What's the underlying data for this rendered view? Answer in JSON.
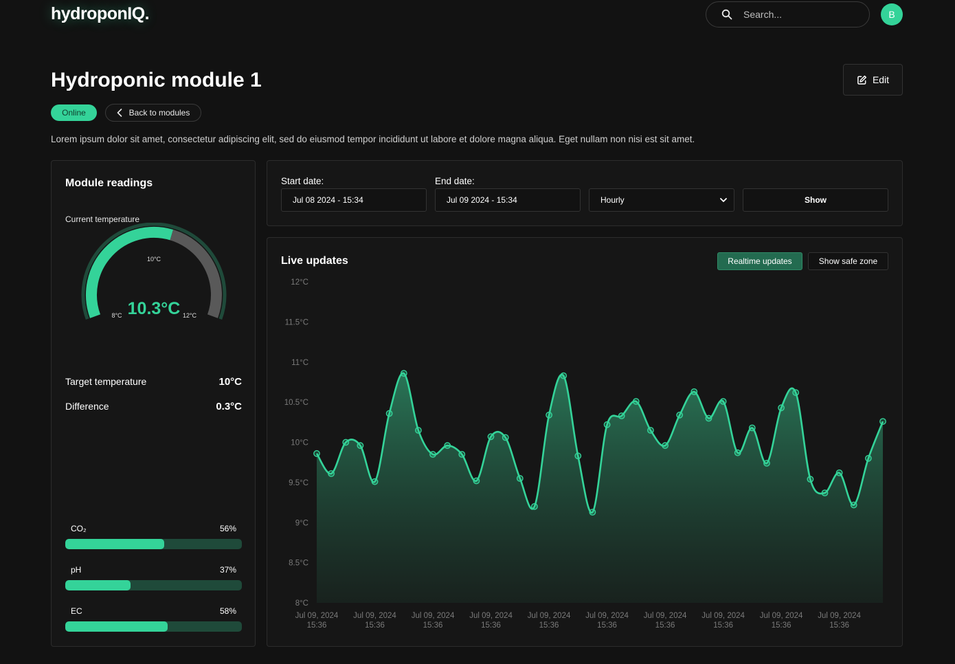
{
  "header": {
    "logo": "hydroponIQ.",
    "search_placeholder": "Search...",
    "avatar_initial": "B"
  },
  "page": {
    "title": "Hydroponic module 1",
    "edit_label": "Edit",
    "status_badge": "Online",
    "back_label": "Back to modules",
    "description": "Lorem ipsum dolor sit amet, consectetur adipiscing elit, sed do eiusmod tempor incididunt ut labore et dolore magna aliqua. Eget nullam non nisi est sit amet."
  },
  "readings": {
    "title": "Module readings",
    "gauge": {
      "label": "Current temperature",
      "value": "10.3°C",
      "current": 10.3,
      "min": 8,
      "max": 12,
      "target": 10,
      "min_label": "8°C",
      "mid_label": "10°C",
      "max_label": "12°C"
    },
    "target_label": "Target temperature",
    "target_value": "10°C",
    "difference_label": "Difference",
    "difference_value": "0.3°C",
    "bars": [
      {
        "label": "CO₂",
        "percent_label": "56%",
        "percent": 56
      },
      {
        "label": "pH",
        "percent_label": "37%",
        "percent": 37
      },
      {
        "label": "EC",
        "percent_label": "58%",
        "percent": 58
      }
    ]
  },
  "filters": {
    "start_label": "Start date:",
    "start_value": "Jul 08 2024 - 15:34",
    "end_label": "End date:",
    "end_value": "Jul 09 2024 - 15:34",
    "interval_value": "Hourly",
    "show_label": "Show"
  },
  "live": {
    "title": "Live updates",
    "realtime_label": "Realtime updates",
    "safe_zone_label": "Show safe zone"
  },
  "colors": {
    "accent": "#34d399",
    "accent_dark": "#236b50",
    "background": "#121212",
    "card": "#161616",
    "gauge_remaining": "#595959"
  },
  "chart_data": {
    "type": "area",
    "ylabel_unit": "°C",
    "ylim": [
      8,
      12
    ],
    "y_ticks": [
      "12°C",
      "11.5°C",
      "11°C",
      "10.5°C",
      "10°C",
      "9.5°C",
      "9°C",
      "8.5°C",
      "8°C"
    ],
    "x_tick_labels": [
      [
        "Jul 09, 2024",
        "15:36"
      ],
      [
        "Jul 09, 2024",
        "15:36"
      ],
      [
        "Jul 09, 2024",
        "15:36"
      ],
      [
        "Jul 09, 2024",
        "15:36"
      ],
      [
        "Jul 09, 2024",
        "15:36"
      ],
      [
        "Jul 09, 2024",
        "15:36"
      ],
      [
        "Jul 09, 2024",
        "15:36"
      ],
      [
        "Jul 09, 2024",
        "15:36"
      ],
      [
        "Jul 09, 2024",
        "15:36"
      ],
      [
        "Jul 09, 2024",
        "15:36"
      ]
    ],
    "series": [
      {
        "values": [
          9.86,
          9.61,
          10.0,
          9.96,
          9.51,
          10.36,
          10.86,
          10.15,
          9.85,
          9.96,
          9.85,
          9.52,
          10.07,
          10.06,
          9.55,
          9.2,
          10.34,
          10.83,
          9.83,
          9.13,
          10.22,
          10.33,
          10.51,
          10.15,
          9.96,
          10.34,
          10.63,
          10.3,
          10.51,
          9.87,
          10.18,
          9.74,
          10.43,
          10.62,
          9.54,
          9.37,
          9.62,
          9.22,
          9.8,
          10.26
        ]
      }
    ]
  }
}
